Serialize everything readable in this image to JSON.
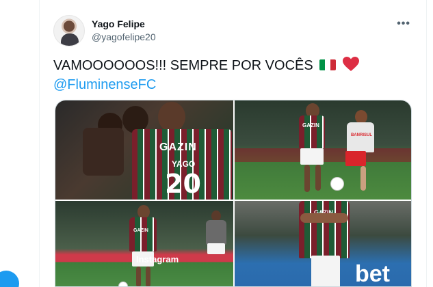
{
  "tweet": {
    "display_name": "Yago Felipe",
    "handle": "@yagofelipe20",
    "more_icon": "more-dots-icon",
    "text_line1": "VAMOOOOOOS!!! SEMPRE POR VOCÊS",
    "mention": "@FluminenseFC",
    "emoji": [
      "italy-flag-emoji",
      "red-heart-emoji"
    ]
  },
  "media": {
    "photos": [
      {
        "id": "photo-1",
        "jersey_sponsor": "GAZIN",
        "jersey_name": "YAGO",
        "jersey_number": "20"
      },
      {
        "id": "photo-2",
        "jersey_sponsor": "GAZIN",
        "opponent_sponsor": "BANRISUL"
      },
      {
        "id": "photo-3",
        "jersey_sponsor": "GAZIN",
        "adboard": "Instagram"
      },
      {
        "id": "photo-4",
        "jersey_sponsor": "GAZIN",
        "adboard": "bet"
      }
    ]
  },
  "colors": {
    "link": "#1d9bf0",
    "text": "#0f1419",
    "secondary": "#536471",
    "border": "#eff3f4"
  }
}
